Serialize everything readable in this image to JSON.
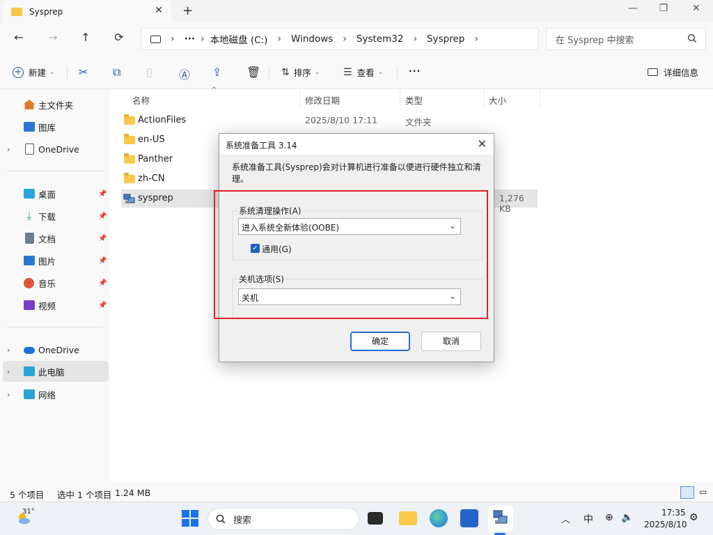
{
  "window": {
    "tab_title": "Sysprep",
    "tab_close": "✕",
    "new_tab": "+",
    "min": "—",
    "max": "❐",
    "close": "✕"
  },
  "nav": {
    "back": "←",
    "forward": "→",
    "up": "↑",
    "refresh": "⟳"
  },
  "address": {
    "more": "···",
    "crumbs": [
      "本地磁盘 (C:)",
      "Windows",
      "System32",
      "Sysprep"
    ],
    "sep": "›"
  },
  "search": {
    "placeholder": "在 Sysprep 中搜索"
  },
  "toolbar": {
    "new_label": "新建",
    "sort_label": "排序",
    "view_label": "查看",
    "more": "···",
    "details_label": "详细信息"
  },
  "sidebar": {
    "items": [
      {
        "label": "主文件夹",
        "icon": "home-icon",
        "color": "#e07a2b"
      },
      {
        "label": "图库",
        "icon": "gallery-icon",
        "color": "#2b76d2"
      },
      {
        "label": "OneDrive",
        "icon": "document-icon",
        "color": "#ffffff"
      },
      {
        "label": "桌面",
        "icon": "desktop-icon",
        "color": "#2aa3d8"
      },
      {
        "label": "下载",
        "icon": "download-icon",
        "color": "#1f9c5a"
      },
      {
        "label": "文档",
        "icon": "documents-icon",
        "color": "#6b7c93"
      },
      {
        "label": "图片",
        "icon": "pictures-icon",
        "color": "#2b76d2"
      },
      {
        "label": "音乐",
        "icon": "music-icon",
        "color": "#e0533a"
      },
      {
        "label": "视频",
        "icon": "video-icon",
        "color": "#7a3fc7"
      },
      {
        "label": "OneDrive",
        "icon": "cloud-icon",
        "color": "#1b6fd6"
      },
      {
        "label": "此电脑",
        "icon": "pc-icon",
        "color": "#2aa3d8"
      },
      {
        "label": "网络",
        "icon": "network-icon",
        "color": "#2aa3d8"
      }
    ]
  },
  "columns": {
    "name": "名称",
    "date": "修改日期",
    "type": "类型",
    "size": "大小"
  },
  "files": [
    {
      "name": "ActionFiles",
      "date": "2025/8/10 17:11",
      "type": "文件夹",
      "size": ""
    },
    {
      "name": "en-US",
      "date": "",
      "type": "",
      "size": ""
    },
    {
      "name": "Panther",
      "date": "",
      "type": "",
      "size": ""
    },
    {
      "name": "zh-CN",
      "date": "",
      "type": "",
      "size": ""
    },
    {
      "name": "sysprep",
      "date": "",
      "type": "",
      "size": "1,276 KB"
    }
  ],
  "status": {
    "count": "5 个项目",
    "selected": "选中 1 个项目",
    "size": "1.24 MB"
  },
  "dialog": {
    "title": "系统准备工具 3.14",
    "close": "✕",
    "description": "系统准备工具(Sysprep)会对计算机进行准备以便进行硬件独立和清理。",
    "cleanup_group": "系统清理操作(A)",
    "cleanup_value": "进入系统全新体验(OOBE)",
    "generalize_label": "通用(G)",
    "generalize_checked": true,
    "shutdown_group": "关机选项(S)",
    "shutdown_value": "关机",
    "ok": "确定",
    "cancel": "取消"
  },
  "taskbar": {
    "weather_temp": "31°",
    "search_label": "搜索",
    "chevron": "︿",
    "ime": "中",
    "time": "17:35",
    "date": "2025/8/10"
  },
  "colors": {
    "accent": "#2a6dd1",
    "highlight": "#e02020",
    "folder": "#f8c94a"
  }
}
